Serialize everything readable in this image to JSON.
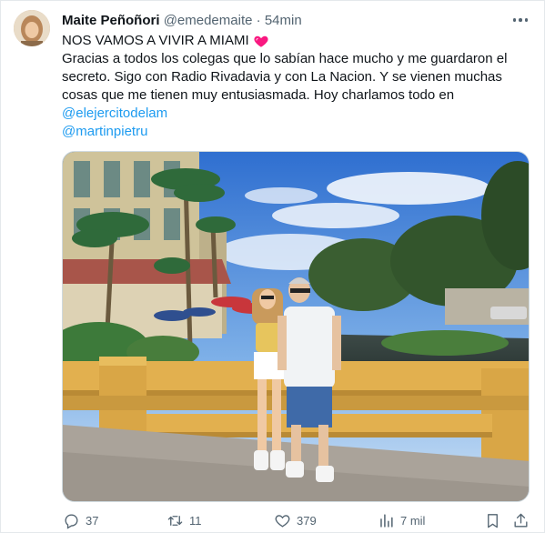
{
  "author": {
    "name": "Maite Peñoñori",
    "handle": "@emedemaite",
    "separator": "·",
    "time": "54min"
  },
  "tweet": {
    "line1": "NOS VAMOS A VIVIR A MIAMI",
    "line1_emoji": "sparkling-heart-icon",
    "body": "Gracias a todos los colegas que lo sabían hace mucho y me guardaron el secreto. Sigo con Radio Rivadavia y con La Nacion. Y se vienen muchas cosas que me tienen muy entusiasmada. Hoy charlamos todo en",
    "mentions": [
      "@elejercitodelam",
      "@martinpietru"
    ]
  },
  "media": {
    "image": "photo-couple-on-bridge-miami"
  },
  "actions": {
    "replies": "37",
    "retweets": "11",
    "likes": "379",
    "views": "7 mil"
  },
  "colors": {
    "link": "#1d9bf0",
    "secondary_text": "#536471",
    "heart": "#f91880"
  }
}
